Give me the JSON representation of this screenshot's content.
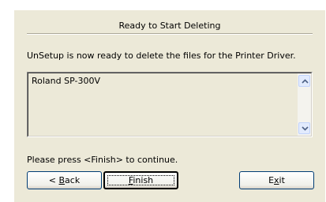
{
  "wizard": {
    "heading": "Ready to Start Deleting",
    "message": "UnSetup is now ready to delete the files for the Printer Driver.",
    "list_items": [
      "Roland SP-300V"
    ],
    "footer_text": "Please press <Finish> to continue."
  },
  "buttons": {
    "back": {
      "prefix": "< ",
      "mnemonic": "B",
      "rest": "ack"
    },
    "finish": {
      "mnemonic": "F",
      "rest": "inish"
    },
    "exit": {
      "prefix": "E",
      "mnemonic": "x",
      "rest": "it"
    }
  },
  "icons": {
    "scroll_up": "chevron-up-icon",
    "scroll_down": "chevron-down-icon"
  },
  "colors": {
    "dialog_bg": "#ece9d8",
    "button_border": "#003c74",
    "scroll_button": "#e2ebfd"
  }
}
